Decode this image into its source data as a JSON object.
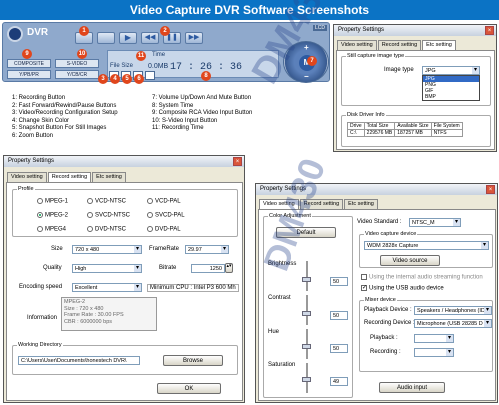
{
  "banner": "Video Capture DVR Software Screenshots",
  "dvr": {
    "title": "DVR",
    "btn_composite": "COMPOSITE",
    "btn_svideo": "S-VIDEO",
    "btn_ypbpr": "Y/PB/PR",
    "btn_ycbcr": "Y/CB/CR",
    "time_label": "Time",
    "filesize_label": "File Size",
    "filesize_value": "0.0MB",
    "time_value": "17 : 26 : 36",
    "center_label": "M",
    "plus": "+",
    "minus": "−",
    "corner": "LCD"
  },
  "legend_left": [
    "1: Recording Button",
    "2: Fast Forward/Rewind/Pause Buttons",
    "3: Video/Recording Configuration Setup",
    "4: Change Skin Color",
    "5: Snapshot Button For Still Images",
    "6: Zoom Button"
  ],
  "legend_right": [
    "7: Volume Up/Down And Mute Button",
    "8: System Time",
    "9: Composite RCA Video Input Button",
    "10: S-Video Input Button",
    "11: Recording Time"
  ],
  "badges": [
    "1",
    "2",
    "3",
    "4",
    "5",
    "6",
    "7",
    "8",
    "9",
    "10",
    "11"
  ],
  "win1": {
    "title": "Property Settings",
    "tabs": [
      "Video setting",
      "Record setting",
      "Etc setting"
    ],
    "group": "Still capture image type",
    "image_type_label": "Image type",
    "image_type_value": "JPG",
    "options": [
      "JPG",
      "PNG",
      "GIF",
      "BMP"
    ],
    "disk_group": "Disk Driver Info",
    "headers": [
      "Drive",
      "Total Size",
      "Available Size",
      "File System"
    ],
    "row": [
      "C:\\",
      "229576 MB",
      "187257 MB",
      "NTFS"
    ]
  },
  "win2": {
    "title": "Property Settings",
    "tabs": [
      "Video setting",
      "Record setting",
      "Etc setting"
    ],
    "profile_label": "Profile",
    "profiles": [
      "MPEG-1",
      "VCD-NTSC",
      "VCD-PAL",
      "MPEG-2",
      "SVCD-NTSC",
      "SVCD-PAL",
      "MPEG4",
      "DVD-NTSC",
      "DVD-PAL"
    ],
    "size_label": "Size",
    "size_value": "720 x 480",
    "framerate_label": "FrameRate",
    "framerate_value": "29.97",
    "quality_label": "Quality",
    "quality_value": "High",
    "bitrate_label": "Bitrate",
    "bitrate_value": "1250",
    "encoding_label": "Encoding speed",
    "encoding_value": "Excellent",
    "min_cpu": "Minimum CPU : Intel P3 600 Mh",
    "info_label": "Information",
    "info_lines": [
      "MPEG-2",
      "Size : 720 x 480",
      "Frame Rate : 30.00 FPS",
      "CBR : 6000000 bps"
    ],
    "workdir_label": "Working Directory",
    "workdir_value": "C:\\Users\\User\\Documents\\honestech DVR\\",
    "browse": "Browse",
    "ok": "OK"
  },
  "win3": {
    "title": "Property Settings",
    "tabs": [
      "Video setting",
      "Record setting",
      "Etc setting"
    ],
    "color_adj": "Color Adjustment",
    "default_btn": "Default",
    "brightness": "Brightness",
    "contrast": "Contrast",
    "hue": "Hue",
    "saturation": "Saturation",
    "v_brightness": "50",
    "v_contrast": "50",
    "v_hue": "50",
    "v_saturation": "49",
    "video_standard_label": "Video Standard :",
    "video_standard_value": "NTSC_M",
    "capture_group": "Video capture device",
    "capture_value": "WDM 2828x Capture",
    "video_source": "Video source",
    "internal_audio": "Using the internal audio streaming function",
    "usb_audio": "Using the USB audio device",
    "mixer_group": "Mixer device",
    "playback_device_label": "Playback Device :",
    "playback_device_value": "Speakers / Headphones (ID",
    "recording_device_label": "Recording Device :",
    "recording_device_value": "Microphone (USB 28285 D",
    "playback_label": "Playback :",
    "recording_label": "Recording :",
    "audio_input": "Audio input"
  },
  "watermark": "DM430"
}
